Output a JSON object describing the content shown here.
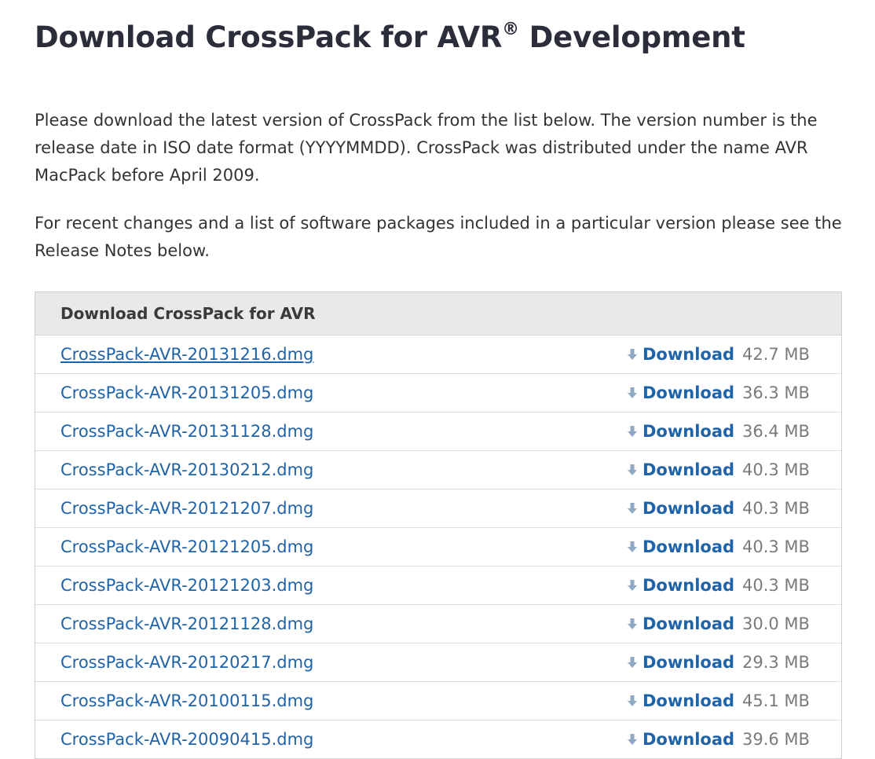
{
  "page": {
    "title": "Download CrossPack for AVR",
    "title_reg": "®",
    "title_suffix": " Development",
    "intro": "Please download the latest version of CrossPack from the list below. The version number is the release date in ISO date format (YYYYMMDD). CrossPack was distributed under the name AVR MacPack before April 2009.",
    "intro2": "For recent changes and a list of software packages included in a particular version please see the Release Notes below."
  },
  "table": {
    "header": "Download CrossPack for AVR",
    "download_label": "Download",
    "rows": [
      {
        "file": "CrossPack-AVR-20131216.dmg",
        "size": "42.7 MB"
      },
      {
        "file": "CrossPack-AVR-20131205.dmg",
        "size": "36.3 MB"
      },
      {
        "file": "CrossPack-AVR-20131128.dmg",
        "size": "36.4 MB"
      },
      {
        "file": "CrossPack-AVR-20130212.dmg",
        "size": "40.3 MB"
      },
      {
        "file": "CrossPack-AVR-20121207.dmg",
        "size": "40.3 MB"
      },
      {
        "file": "CrossPack-AVR-20121205.dmg",
        "size": "40.3 MB"
      },
      {
        "file": "CrossPack-AVR-20121203.dmg",
        "size": "40.3 MB"
      },
      {
        "file": "CrossPack-AVR-20121128.dmg",
        "size": "30.0 MB"
      },
      {
        "file": "CrossPack-AVR-20120217.dmg",
        "size": "29.3 MB"
      },
      {
        "file": "CrossPack-AVR-20100115.dmg",
        "size": "45.1 MB"
      },
      {
        "file": "CrossPack-AVR-20090415.dmg",
        "size": "39.6 MB"
      }
    ]
  },
  "icons": {
    "download": "download-arrow-icon"
  },
  "colors": {
    "link": "#1f63a8",
    "title": "#2b2d3b",
    "header_bg": "#e9e9e9",
    "size_text": "#7a7a7a"
  }
}
